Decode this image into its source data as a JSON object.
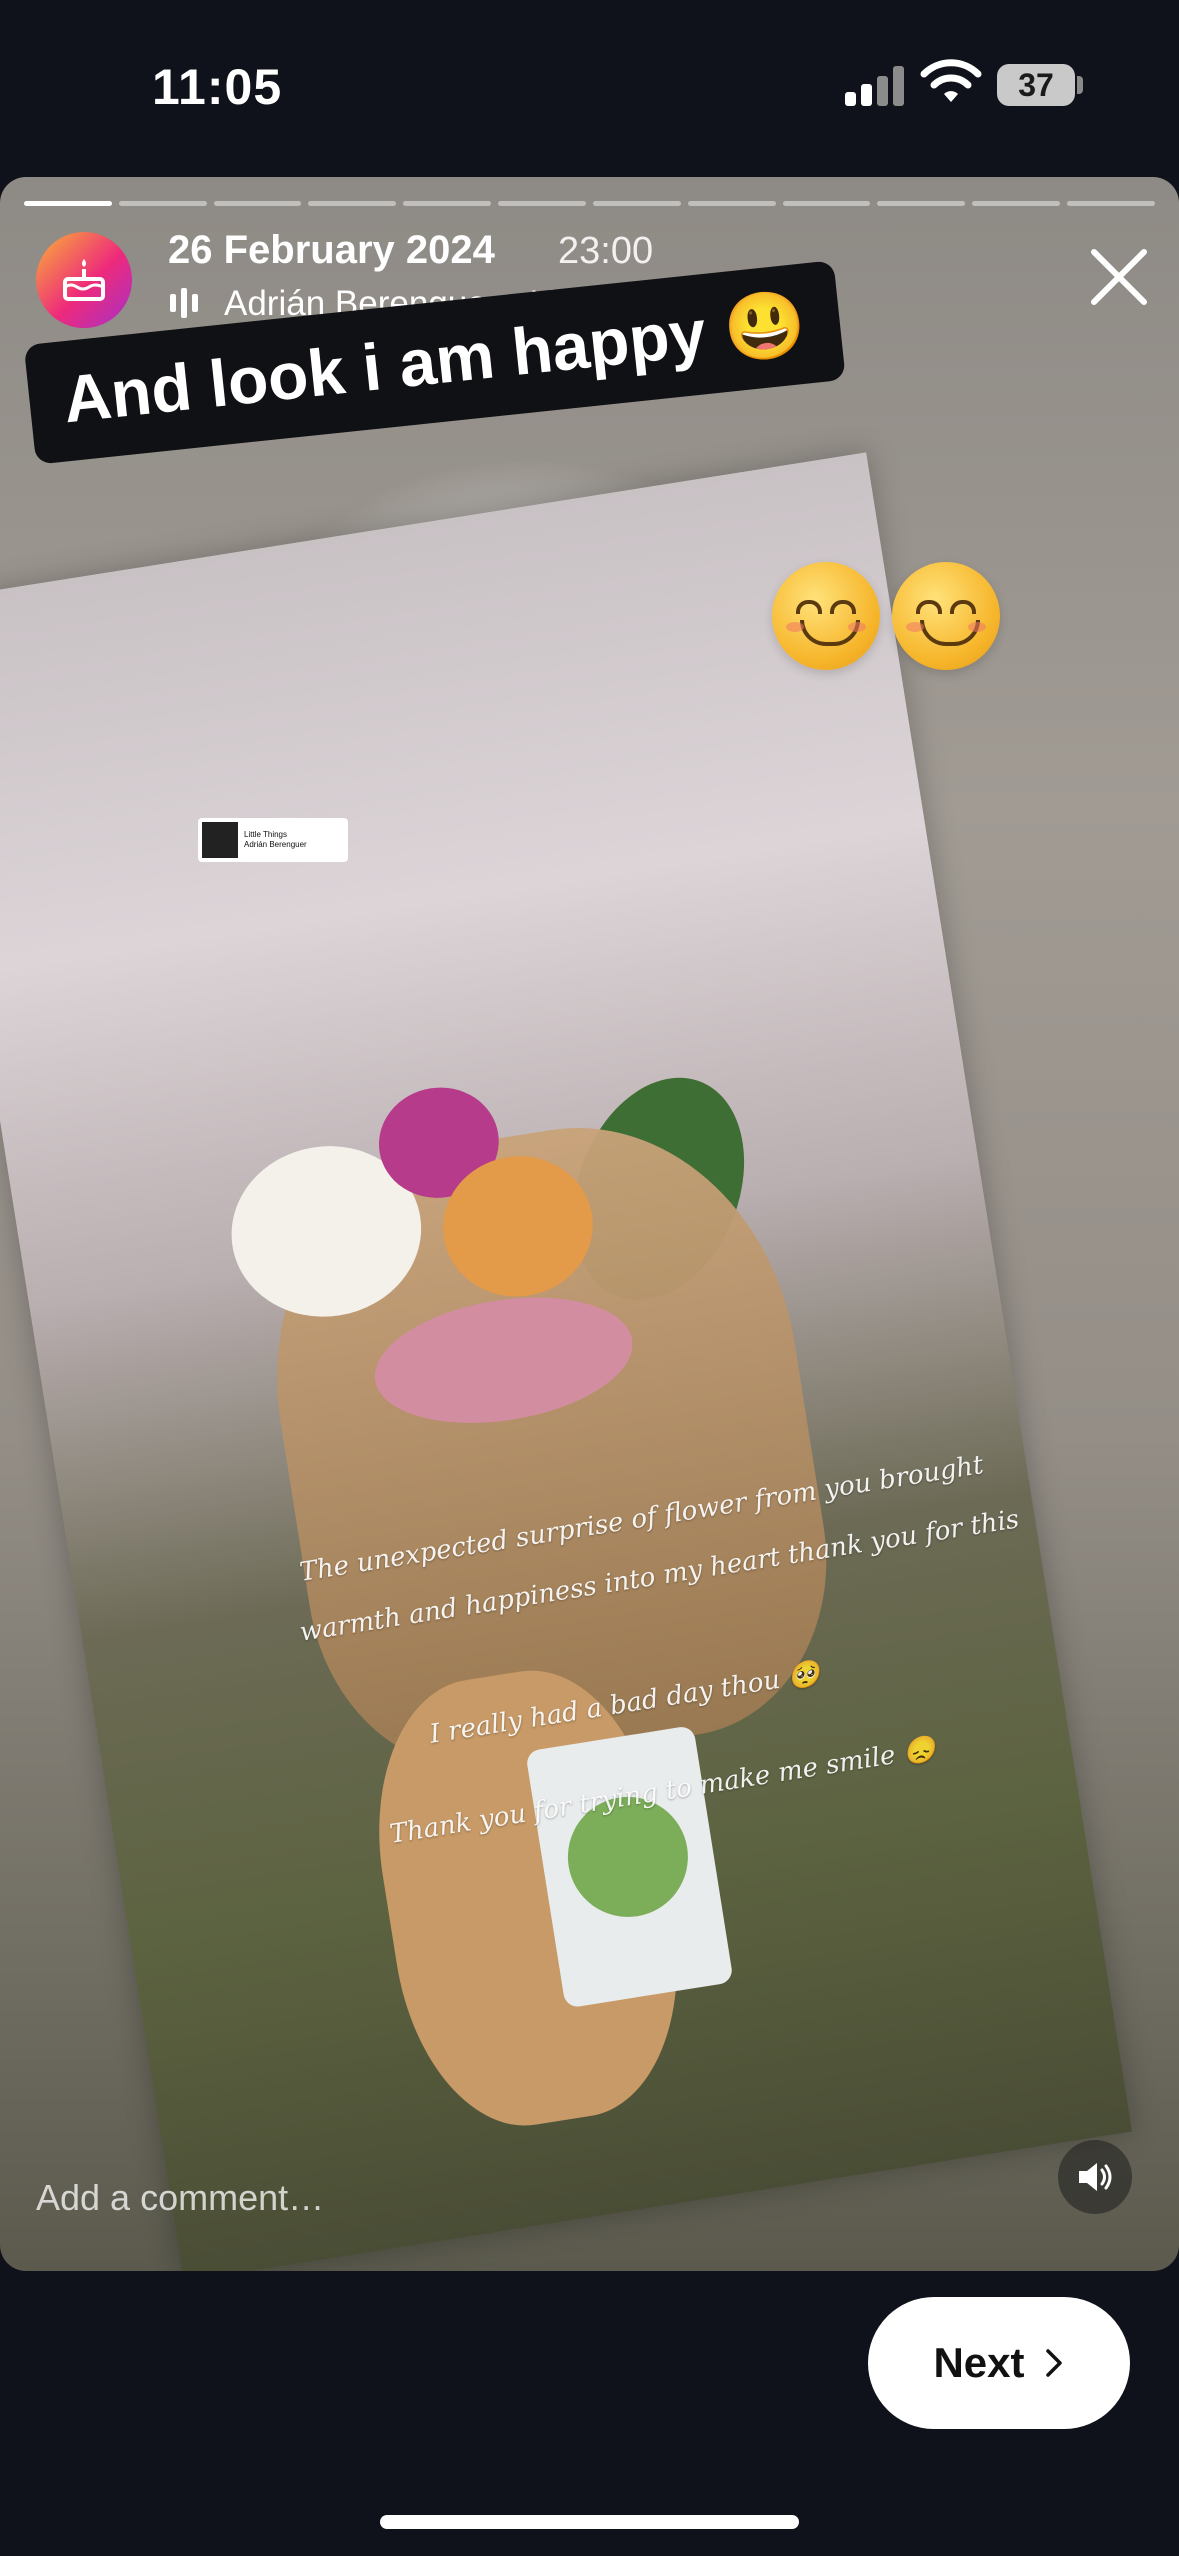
{
  "status_bar": {
    "time": "11:05",
    "battery": "37"
  },
  "story": {
    "progress_total": 12,
    "progress_active_index": 0,
    "date": "26 February 2024",
    "time": "23:00",
    "music": "Adrián Berenguer · Little Things ›",
    "caption": "And look i am happy 😃",
    "music_sticker": {
      "title": "Little Things",
      "artist": "Adrián Berenguer"
    },
    "handwriting": [
      "The unexpected surprise of flower from you brought",
      "warmth and happiness into my heart thank you for this",
      "I really had a bad day thou 🥺",
      "Thank you for trying to make me smile 😞"
    ],
    "comment_placeholder": "Add a comment…"
  },
  "footer": {
    "next_label": "Next"
  },
  "colors": {
    "background": "#0f121a",
    "avatar_gradient_start": "#f9b336",
    "avatar_gradient_end": "#a531c9"
  },
  "icons": {
    "avatar": "birthday-cake-icon",
    "close": "close-icon",
    "sound": "speaker-icon",
    "music": "audio-wave-icon",
    "next": "chevron-right-icon"
  }
}
